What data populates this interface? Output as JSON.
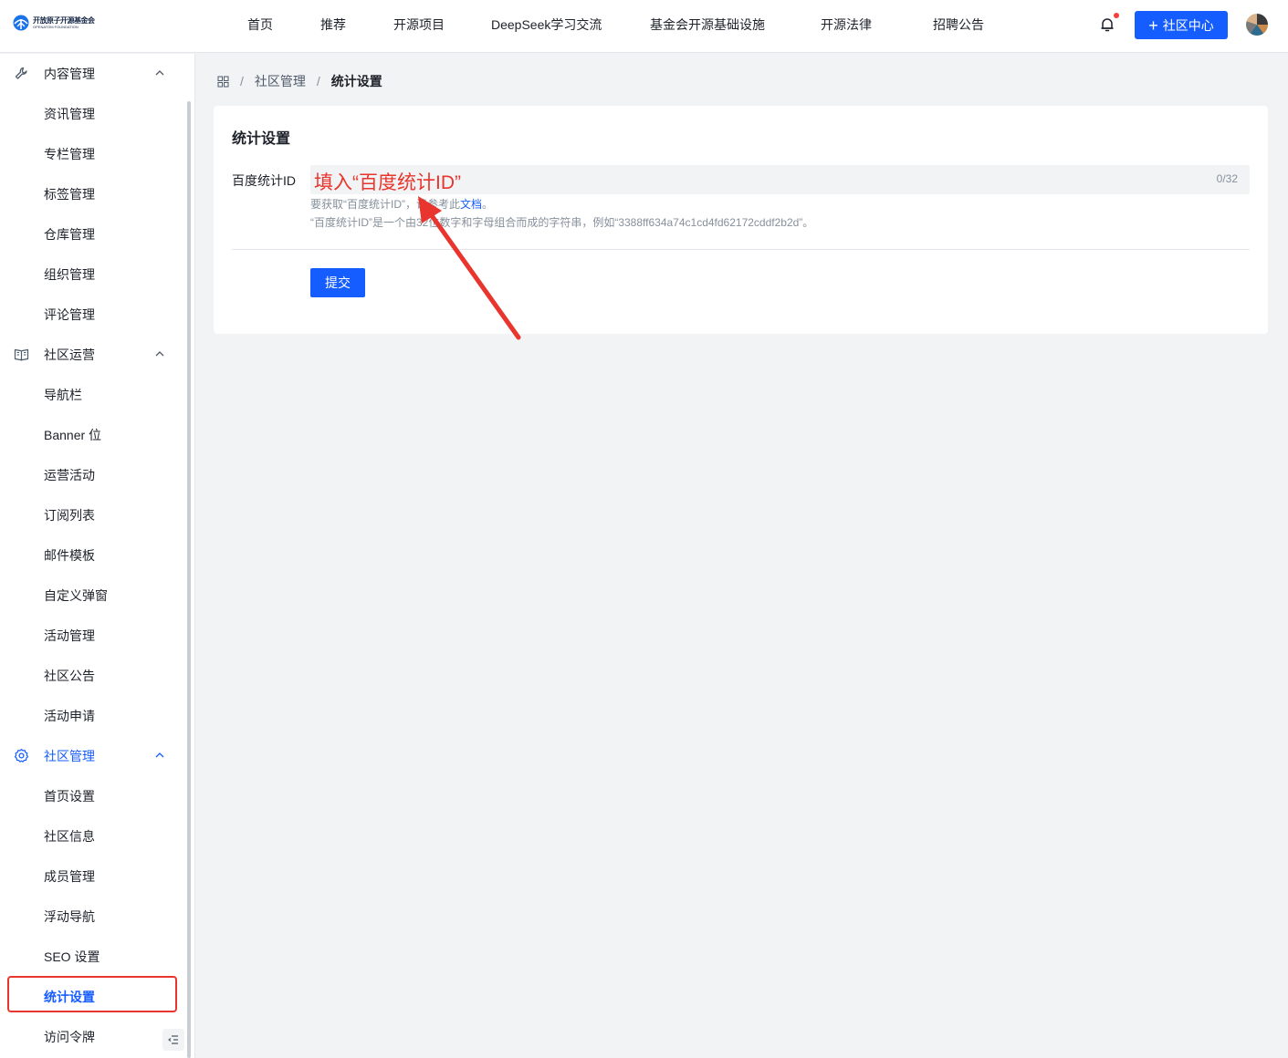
{
  "header": {
    "logo_cn": "开放原子开源基金会",
    "logo_en": "OPENATOM FOUNDATION",
    "nav": [
      "首页",
      "推荐",
      "开源项目",
      "DeepSeek学习交流",
      "基金会开源基础设施",
      "开源法律",
      "招聘公告"
    ],
    "cta_label": "社区中心"
  },
  "sidebar": {
    "groups": [
      {
        "label": "内容管理",
        "icon": "wrench-icon",
        "items": [
          "资讯管理",
          "专栏管理",
          "标签管理",
          "仓库管理",
          "组织管理",
          "评论管理"
        ]
      },
      {
        "label": "社区运营",
        "icon": "book-icon",
        "items": [
          "导航栏",
          "Banner 位",
          "运营活动",
          "订阅列表",
          "邮件模板",
          "自定义弹窗",
          "活动管理",
          "社区公告",
          "活动申请"
        ]
      },
      {
        "label": "社区管理",
        "icon": "gear-icon",
        "items": [
          "首页设置",
          "社区信息",
          "成员管理",
          "浮动导航",
          "SEO 设置",
          "统计设置",
          "访问令牌"
        ]
      }
    ],
    "active_item": "统计设置"
  },
  "breadcrumb": {
    "parent": "社区管理",
    "current": "统计设置"
  },
  "card": {
    "title": "统计设置",
    "field_label": "百度统计ID",
    "input_value": "填入“百度统计ID”",
    "counter": "0/32",
    "help1_prefix": "要获取“百度统计ID”，请参考此",
    "help1_link": "文档",
    "help1_suffix": "。",
    "help2": "“百度统计ID”是一个由32位数字和字母组合而成的字符串，例如“3388ff634a74c1cd4fd62172cddf2b2d”。",
    "submit_label": "提交"
  },
  "colors": {
    "accent": "#165dff",
    "annotation": "#e8352d"
  }
}
